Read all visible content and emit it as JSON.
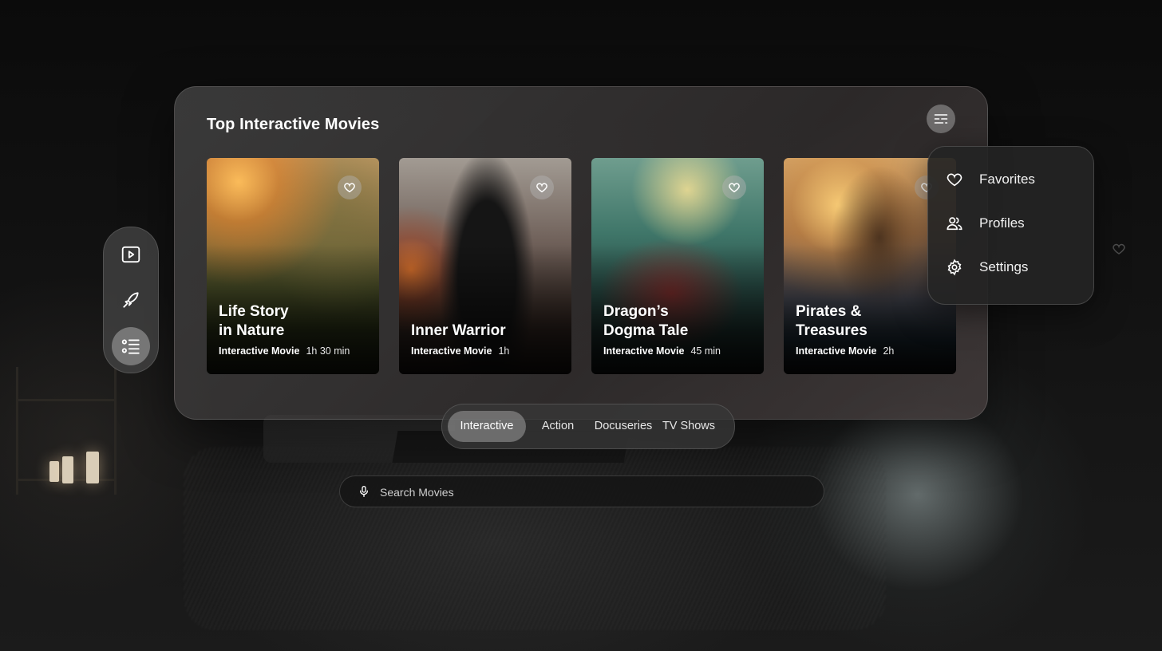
{
  "panel": {
    "title": "Top Interactive Movies"
  },
  "movies": [
    {
      "title_line1": "Life Story",
      "title_line2": "in Nature",
      "genre": "Interactive Movie",
      "duration": "1h 30 min"
    },
    {
      "title_line1": "",
      "title_line2": "Inner Warrior",
      "genre": "Interactive Movie",
      "duration": "1h"
    },
    {
      "title_line1": "Dragon’s",
      "title_line2": "Dogma Tale",
      "genre": "Interactive Movie",
      "duration": "45 min"
    },
    {
      "title_line1": "Pirates &",
      "title_line2": "Treasures",
      "genre": "Interactive Movie",
      "duration": "2h"
    }
  ],
  "sidenav": {
    "items": [
      {
        "icon": "play-icon",
        "active": false
      },
      {
        "icon": "rocket-icon",
        "active": false
      },
      {
        "icon": "list-icon",
        "active": true
      }
    ]
  },
  "menu": {
    "items": [
      {
        "label": "Favorites",
        "icon": "heart-icon"
      },
      {
        "label": "Profiles",
        "icon": "users-icon"
      },
      {
        "label": "Settings",
        "icon": "gear-icon"
      }
    ]
  },
  "tabs": [
    {
      "label": "Interactive",
      "active": true
    },
    {
      "label": "Action",
      "active": false
    },
    {
      "label": "Docuseries",
      "active": false
    },
    {
      "label": "TV Shows",
      "active": false
    }
  ],
  "search": {
    "placeholder": "Search Movies",
    "value": ""
  },
  "colors": {
    "accent": "#ffffff",
    "panel": "#3f3d3d",
    "active_chip": "#8f8f8f"
  }
}
